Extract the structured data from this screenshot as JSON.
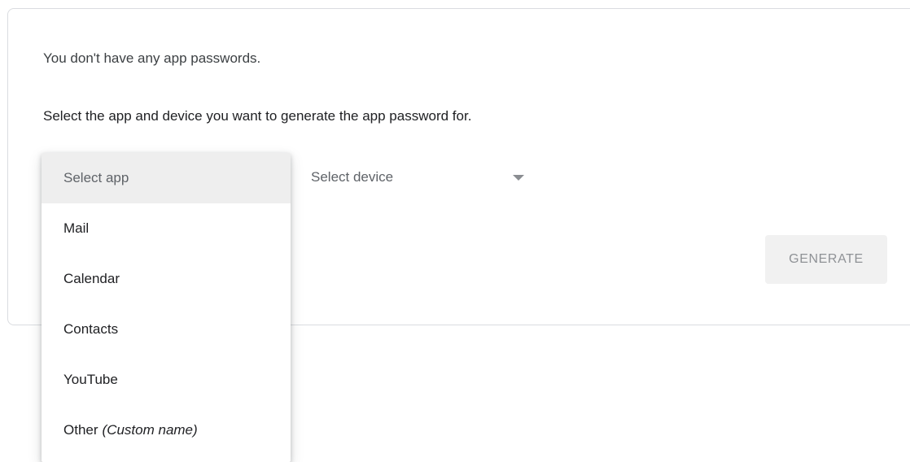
{
  "message": {
    "no_passwords": "You don't have any app passwords.",
    "instructions": "Select the app and device you want to generate the app password for."
  },
  "app_menu": {
    "items": [
      {
        "label": "Select app",
        "hint": ""
      },
      {
        "label": "Mail",
        "hint": ""
      },
      {
        "label": "Calendar",
        "hint": ""
      },
      {
        "label": "Contacts",
        "hint": ""
      },
      {
        "label": "YouTube",
        "hint": ""
      },
      {
        "label": "Other",
        "hint": "(Custom name)"
      }
    ]
  },
  "device_select": {
    "label": "Select device",
    "icon": "chevron-down-icon"
  },
  "actions": {
    "generate_label": "GENERATE"
  },
  "colors": {
    "border": "#dadce0",
    "selected_bg": "#eeeeee",
    "disabled_button_bg": "#f1f1f1",
    "disabled_button_text": "#8f9296"
  }
}
